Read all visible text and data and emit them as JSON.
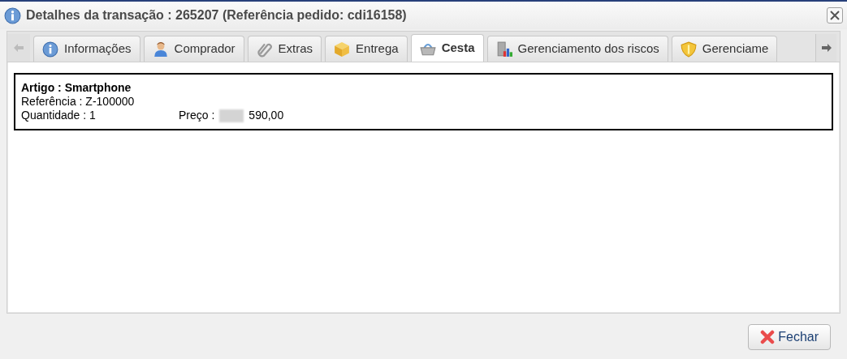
{
  "window": {
    "title": "Detalhes da transação : 265207 (Referência pedido: cdi16158)"
  },
  "tabs": [
    {
      "label": "Informações",
      "kind": "info",
      "selected": false
    },
    {
      "label": "Comprador",
      "kind": "person",
      "selected": false
    },
    {
      "label": "Extras",
      "kind": "clip",
      "selected": false
    },
    {
      "label": "Entrega",
      "kind": "box",
      "selected": false
    },
    {
      "label": "Cesta",
      "kind": "basket",
      "selected": true
    },
    {
      "label": "Gerenciamento dos riscos",
      "kind": "chart",
      "selected": false
    },
    {
      "label": "Gerenciame",
      "kind": "shield",
      "selected": false
    }
  ],
  "item": {
    "title": "Artigo : Smartphone",
    "reference": "Referência : Z-100000",
    "quantity": "Quantidade : 1",
    "price_label": "Preço :",
    "price": "590,00"
  },
  "buttons": [
    {
      "label": "Fechar"
    }
  ]
}
